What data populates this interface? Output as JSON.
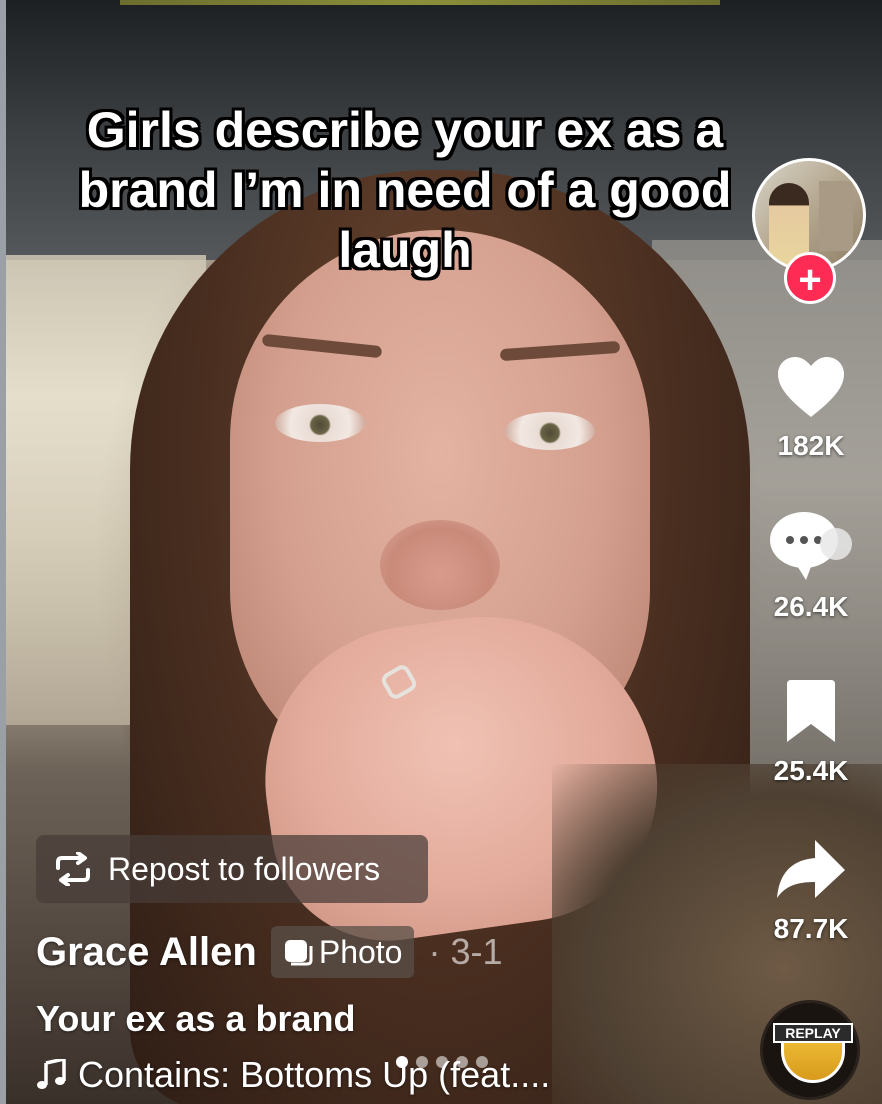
{
  "caption": "Girls describe your ex as a\nbrand I’m in need of a good\nlaugh",
  "actions": {
    "like_count": "182K",
    "comment_count": "26.4K",
    "save_count": "25.4K",
    "share_count": "87.7K"
  },
  "follow_symbol": "+",
  "repost_label": "Repost to followers",
  "creator": {
    "name": "Grace Allen",
    "content_type": "Photo",
    "date": "· 3-1"
  },
  "description": "Your ex as a brand",
  "music": "Contains: Bottoms Up (feat....",
  "carousel": {
    "count": 5,
    "active_index": 0
  },
  "replay_badge": "REPLAY",
  "colors": {
    "follow_accent": "#fe2c55",
    "text": "#ffffff"
  },
  "icons": [
    "heart-icon",
    "comment-icon",
    "bookmark-icon",
    "share-icon",
    "repost-icon",
    "photo-icon",
    "music-note-icon"
  ]
}
